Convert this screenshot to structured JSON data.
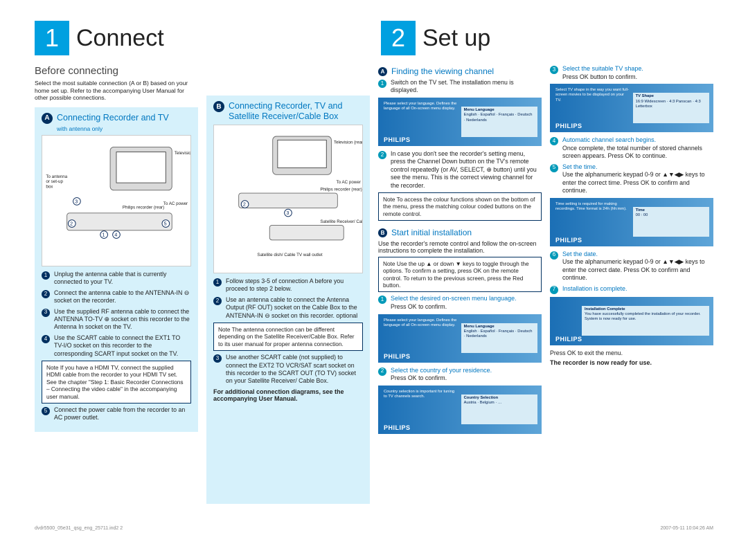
{
  "headers": {
    "h1_num": "1",
    "h1_title": "Connect",
    "h2_num": "2",
    "h2_title": "Set up"
  },
  "before": {
    "title": "Before connecting",
    "intro": "Select the most suitable connection (A or B) based on your home set up.  Refer to the accompanying User Manual for other possible connections."
  },
  "panelA": {
    "letter": "A",
    "title": "Connecting Recorder and TV",
    "subtitle": "with antenna only",
    "diagram": {
      "to_antenna": "To antenna or set-up box",
      "television": "Television (rear)",
      "to_ac": "To AC power",
      "recorder": "Philips recorder (rear)"
    },
    "steps": {
      "s1": "Unplug the antenna cable that is currently connected to your TV.",
      "s2": "Connect the antenna cable to the ANTENNA-IN ⊖ socket on the recorder.",
      "s3": "Use the supplied RF antenna cable to connect the ANTENNA TO-TV ⊕ socket on this recorder to the Antenna In socket on the TV.",
      "s4": "Use the SCART cable to connect the EXT1 TO TV-I/O socket on this recorder to the corresponding SCART input socket on the TV.",
      "note": "Note If you have a HDMI TV, connect the supplied HDMI cable from the recorder to your HDMI TV set. See the chapter \"Step 1: Basic Recorder Connections – Connecting the video cable\" in the accompanying user manual.",
      "s5": "Connect the power cable from the recorder to an AC power outlet."
    }
  },
  "panelB": {
    "letter": "B",
    "title": "Connecting Recorder, TV and Satellite Receiver/Cable Box",
    "diagram": {
      "television": "Television (rear)",
      "to_ac": "To AC power",
      "recorder": "Philips recorder (rear)",
      "satbox": "Satellite Receiver/ Cable Box (rear)",
      "wall": "Satellite dish/ Cable TV wall outlet"
    },
    "steps": {
      "s1": "Follow steps 3-5 of connection A before you proceed to step 2 below.",
      "s2": "Use an antenna cable to connect the Antenna Output (RF OUT) socket on the Cable Box to the ANTENNA-IN ⊖ socket on this recorder. optional",
      "note": "Note The antenna connection can be different depending on the Satellite Receiver/Cable Box. Refer to its user manual for proper antenna connection.",
      "s3": "Use another SCART cable (not supplied) to connect the EXT2 TO VCR/SAT scart socket on this recorder to the SCART OUT (TO TV) socket on your Satellite Receiver/ Cable Box.",
      "footer": "For additional connection diagrams, see the accompanying User Manual."
    }
  },
  "setup": {
    "secA": {
      "letter": "A",
      "title": "Finding the viewing channel",
      "s1": "Switch on the TV set. The installation menu is displayed.",
      "osd1_caption": "Please select your language. Defines the language of all On-screen menu display.",
      "osd1_panel_title": "Menu Language",
      "osd1_items": "English · Español · Français · Deutsch · Nederlands",
      "s2": "In case you don't see the recorder's setting menu, press the Channel Down button on the TV's remote control repeatedly (or AV, SELECT, ⊕ button) until you see the menu.  This is the correct viewing channel for the recorder.",
      "note": "Note To access the colour functions shown on the bottom of the menu, press the matching colour coded buttons on the remote control."
    },
    "secB": {
      "letter": "B",
      "title": "Start initial installation",
      "intro": "Use the recorder's remote control and follow the on-screen instructions to complete the installation.",
      "note": "Note  Use the up ▲ or down ▼ keys to toggle through the options. To confirm a setting, press OK on the remote control. To return to the previous screen, press the Red button.",
      "s1_blue": "Select the desired on-screen menu language.",
      "s1_body": "Press OK to confirm.",
      "osd1_caption": "Please select your language. Defines the language of all On-screen menu display.",
      "osd1_panel_title": "Menu Language",
      "osd1_items": "English · Español · Français · Deutsch · Nederlands",
      "s2_blue": "Select the country of your residence.",
      "s2_body": "Press OK to confirm.",
      "osd2_caption": "Country selection is important for tuning to TV channels search.",
      "osd2_panel_title": "Country Selection",
      "osd2_items": "Austria · Belgium · …"
    },
    "colR": {
      "s3_blue": "Select the suitable TV shape.",
      "s3_body": "Press OK button to confirm.",
      "osd3_caption": "Select TV shape in the way you want full-screen movies to be displayed on your TV.",
      "osd3_panel_title": "TV Shape",
      "osd3_items": "16:9 Widescreen · 4:3 Panscan · 4:3 Letterbox",
      "s4_blue": "Automatic channel search begins.",
      "s4_body": "Once complete, the total number of stored channels screen appears. Press OK to continue.",
      "s5_blue": "Set the time.",
      "s5_body": "Use the alphanumeric keypad 0-9 or ▲▼◀▶ keys to enter the correct time. Press OK to confirm and continue.",
      "osd5_caption": "Time setting is required for making recordings. Time format is 24h (hh:mm).",
      "osd5_panel_title": "Time",
      "osd5_items": "00 : 00",
      "s6_blue": "Set the date.",
      "s6_body": "Use the alphanumeric keypad 0-9 or ▲▼◀▶ keys to enter the correct date. Press OK  to confirm and continue.",
      "s7_blue": "Installation is complete.",
      "osd7_panel_title": "Installation Complete",
      "osd7_items": "You have successfully completed the installation of your recorder. System is now ready for use.",
      "exit": "Press OK to exit the menu.",
      "ready": "The recorder is now ready for use."
    }
  },
  "footer": {
    "left": "dvdr5500_05e31_qsg_eng_25711.ind2   2",
    "right": "2007-05-11   10:04:26 AM"
  },
  "brand": "PHILIPS"
}
